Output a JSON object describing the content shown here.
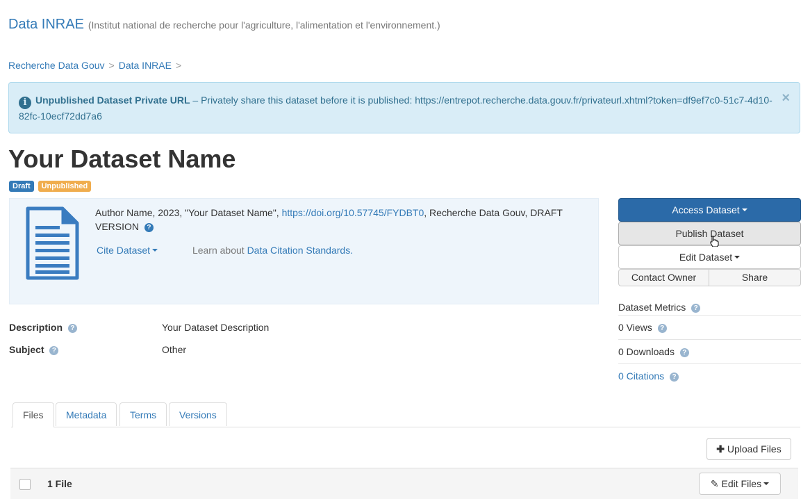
{
  "header": {
    "dataverse_name": "Data INRAE",
    "affiliation": "(Institut national de recherche pour l'agriculture, l'alimentation et l'environnement.)"
  },
  "breadcrumb": {
    "items": [
      "Recherche Data Gouv",
      "Data INRAE"
    ],
    "separator": ">"
  },
  "alert": {
    "title": "Unpublished Dataset Private URL",
    "message": " – Privately share this dataset before it is published: https://entrepot.recherche.data.gouv.fr/privateurl.xhtml?token=df9ef7c0-51c7-4d10-82fc-10ecf72dd7a6",
    "close_glyph": "×"
  },
  "dataset": {
    "title": "Your Dataset Name",
    "labels": {
      "draft": "Draft",
      "unpublished": "Unpublished"
    }
  },
  "citation": {
    "text_before": "Author Name, 2023, \"Your Dataset Name\", ",
    "doi": "https://doi.org/10.57745/FYDBT0",
    "text_after": ", Recherche Data Gouv, DRAFT VERSION",
    "cite_label": "Cite Dataset",
    "learn_prefix": "Learn about ",
    "learn_link": "Data Citation Standards."
  },
  "metadata": {
    "description_key": "Description",
    "description_val": "Your Dataset Description",
    "subject_key": "Subject",
    "subject_val": "Other"
  },
  "actions": {
    "access": "Access Dataset",
    "publish": "Publish Dataset",
    "edit": "Edit Dataset",
    "contact": "Contact Owner",
    "share": "Share"
  },
  "metrics": {
    "title": "Dataset Metrics",
    "views": "0 Views",
    "downloads": "0 Downloads",
    "citations": "0 Citations"
  },
  "tabs": [
    "Files",
    "Metadata",
    "Terms",
    "Versions"
  ],
  "files": {
    "upload_label": "Upload Files",
    "count_label": "1 File",
    "edit_label": "Edit Files"
  },
  "colors": {
    "primary": "#337ab7",
    "info_bg": "#d9edf7",
    "draft": "#337ab7",
    "unpublished": "#f0ad4e"
  }
}
